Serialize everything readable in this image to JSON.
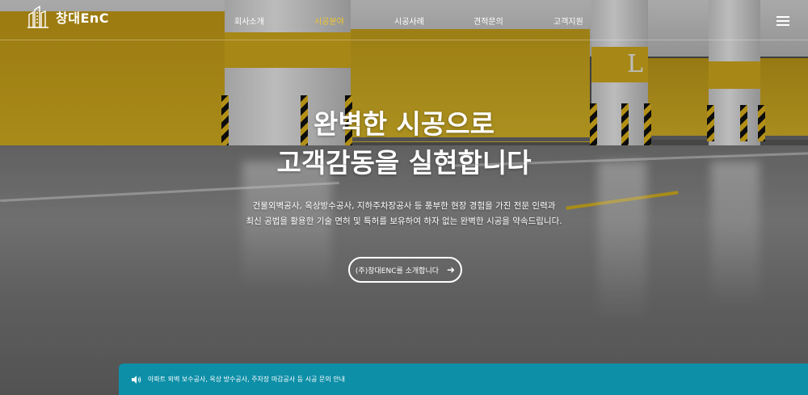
{
  "brand": {
    "name": "창대EnC"
  },
  "nav": {
    "items": [
      {
        "label": "회사소개",
        "active": false
      },
      {
        "label": "시공분야",
        "active": true
      },
      {
        "label": "시공사례",
        "active": false
      },
      {
        "label": "견적문의",
        "active": false
      },
      {
        "label": "고객지원",
        "active": false
      }
    ],
    "menu_icon": "hamburger-menu-icon"
  },
  "scene": {
    "pillar_letter": "L"
  },
  "hero": {
    "title_line1": "완벽한 시공으로",
    "title_line2": "고객감동을 실현합니다",
    "desc_line1": "건물외벽공사, 옥상방수공사, 지하주차장공사 등 풍부한 현장 경험을 가진 전문 인력과",
    "desc_line2": "최신 공법을 활용한 기술 면허 및 특허를 보유하여 하자 없는 완벽한 시공을 약속드립니다.",
    "cta_label": "(주)창대ENC를 소개합니다",
    "cta_icon": "arrow-right-icon"
  },
  "notice": {
    "icon": "speaker-icon",
    "text": "아파트 외벽 보수공사, 옥상 방수공사, 주차장 마감공사 등 시공 문의 안내"
  },
  "colors": {
    "accent": "#f2c72a",
    "notice_bg": "#0e8fa8",
    "wall_yellow": "#d8b21e"
  }
}
